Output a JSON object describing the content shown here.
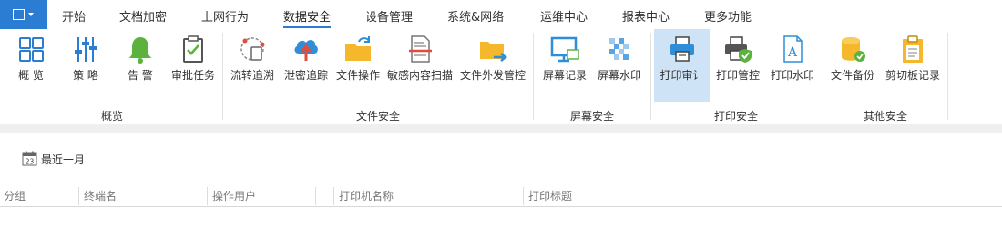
{
  "menubar": {
    "tabs": [
      "开始",
      "文档加密",
      "上网行为",
      "数据安全",
      "设备管理",
      "系统&网络",
      "运维中心",
      "报表中心",
      "更多功能"
    ],
    "active_tab": "数据安全"
  },
  "ribbon": {
    "buttons": {
      "overview": "概 览",
      "policy": "策 略",
      "alert": "告 警",
      "approval": "审批任务",
      "flow_trace": "流转追溯",
      "leak_trace": "泄密追踪",
      "file_ops": "文件操作",
      "sensitive_scan": "敏感内容扫描",
      "outgoing_control": "文件外发管控",
      "screen_record": "屏幕记录",
      "screen_watermark": "屏幕水印",
      "print_audit": "打印审计",
      "print_control": "打印管控",
      "print_watermark": "打印水印",
      "file_backup": "文件备份",
      "clipboard_record": "剪切板记录"
    },
    "groups": {
      "overview": "概览",
      "file_security": "文件安全",
      "screen_security": "屏幕安全",
      "print_security": "打印安全",
      "other_security": "其他安全"
    },
    "selected": "打印审计"
  },
  "toolbar": {
    "date_range": "最近一月",
    "calendar_day": "23"
  },
  "table": {
    "columns": [
      "分组",
      "终端名",
      "操作用户",
      "打印机名称",
      "打印标题"
    ]
  },
  "colors": {
    "accent": "#2b7cd3",
    "selected_bg": "#cfe3f7",
    "alert_green": "#5bb33e",
    "cloud_blue": "#2e8ed8",
    "folder_yellow": "#f5b72c",
    "arrow_red": "#e24c3c"
  }
}
